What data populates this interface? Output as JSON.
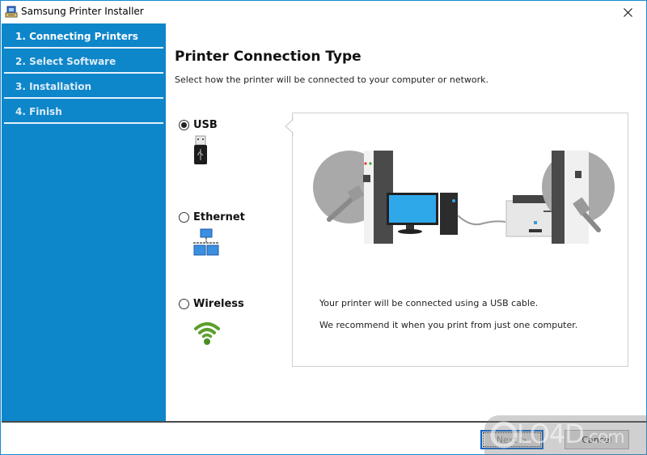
{
  "window": {
    "title": "Samsung Printer Installer",
    "close_icon": "close-icon"
  },
  "sidebar": {
    "steps": [
      {
        "label": "1. Connecting Printers",
        "active": true
      },
      {
        "label": "2. Select Software",
        "active": false
      },
      {
        "label": "3. Installation",
        "active": false
      },
      {
        "label": "4. Finish",
        "active": false
      }
    ],
    "accent_color": "#0e86ca"
  },
  "main": {
    "heading": "Printer Connection Type",
    "subtext": "Select how the printer will be connected to your computer or network.",
    "options": [
      {
        "label": "USB",
        "selected": true,
        "icon": "usb-icon"
      },
      {
        "label": "Ethernet",
        "selected": false,
        "icon": "ethernet-network-icon"
      },
      {
        "label": "Wireless",
        "selected": false,
        "icon": "wifi-icon"
      }
    ],
    "panel": {
      "illustration": "usb-connection-illustration",
      "line1": "Your printer will be connected using a USB cable.",
      "line2": "We recommend it when you print from just one computer."
    }
  },
  "footer": {
    "next_label": "Next >",
    "cancel_label": "Cancel"
  },
  "watermark": {
    "text": "LO4D",
    "suffix": ".com"
  }
}
